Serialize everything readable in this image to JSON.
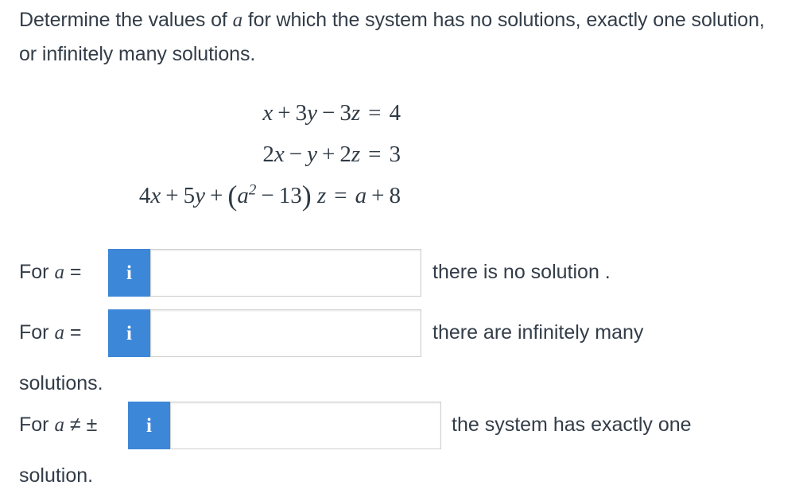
{
  "question": {
    "line1_before_var": "Determine the values of ",
    "variable": "a",
    "line1_after_var": " for which the system has no solutions,",
    "line2": "exactly one solution, or infinitely many solutions."
  },
  "system": {
    "equations": [
      {
        "id": "equation-1",
        "lhs": "x + 3y − 3z",
        "relation": "=",
        "rhs": "4",
        "terms": [
          "x",
          "+",
          "3y",
          "−",
          "3z"
        ]
      },
      {
        "id": "equation-2",
        "lhs": "2x − y + 2z",
        "relation": "=",
        "rhs": "3",
        "terms": [
          "2x",
          "−",
          "y",
          "+",
          "2z"
        ]
      },
      {
        "id": "equation-3",
        "lhs": "4x + 5y + (a² − 13) z",
        "relation": "=",
        "rhs": "a + 8",
        "terms": [
          "4x",
          "+",
          "5y",
          "+",
          "(a² − 13) z"
        ],
        "coefficient_expression": "a^2 - 13",
        "exponent": "2",
        "constant_in_parens": "13",
        "rhs_variable": "a",
        "rhs_constant": "8"
      }
    ]
  },
  "answers": {
    "info_glyph": "i",
    "rows": [
      {
        "id": "no-solution",
        "label_prefix": "For ",
        "label_variable": "a",
        "label_relation": " =",
        "input_value": "",
        "input_placeholder": "",
        "tail_text": "there is no solution .",
        "wrap_text": ""
      },
      {
        "id": "infinitely-many",
        "label_prefix": "For ",
        "label_variable": "a",
        "label_relation": " =",
        "input_value": "",
        "input_placeholder": "",
        "tail_text": "there are infinitely many",
        "wrap_text": "solutions."
      },
      {
        "id": "exactly-one",
        "label_prefix": "For ",
        "label_variable": "a",
        "label_relation": " ≠ ±",
        "input_value": "",
        "input_placeholder": "",
        "tail_text": "the system has exactly one",
        "wrap_text": "solution."
      }
    ]
  },
  "colors": {
    "text": "#333d48",
    "math_text": "#2f3a45",
    "info_button_blue": "#3d87d8",
    "input_border": "#cfcfcf",
    "page_background": "#ffffff"
  }
}
